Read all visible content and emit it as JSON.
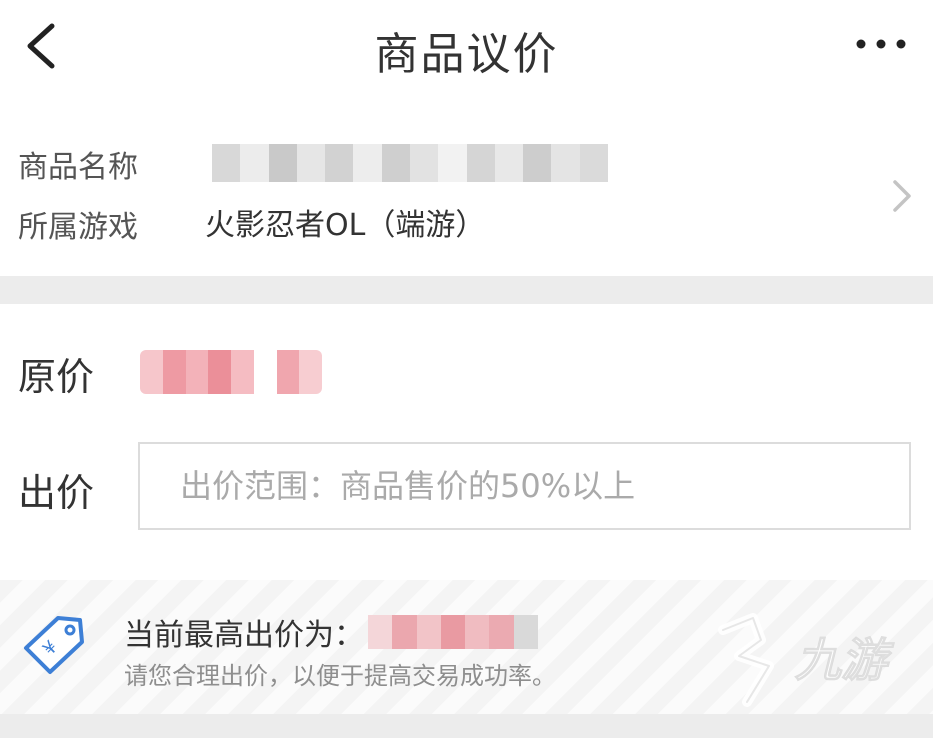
{
  "header": {
    "title": "商品议价",
    "back_icon": "chevron-left-icon",
    "more_icon": "more-horizontal-icon"
  },
  "product": {
    "name_label": "商品名称",
    "game_label": "所属游戏",
    "game_value": "火影忍者OL（端游）",
    "chevron_icon": "chevron-right-icon"
  },
  "pricing": {
    "original_label": "原价",
    "bid_label": "出价",
    "bid_placeholder": "出价范围：商品售价的50%以上",
    "bid_value": ""
  },
  "tip": {
    "icon": "price-tag-icon",
    "highest_prefix": "当前最高出价为：",
    "advice": "请您合理出价，以便于提高交易成功率。"
  },
  "watermark": {
    "text": "九游"
  },
  "colors": {
    "accent_blue": "#3d7fd6",
    "divider_gray": "#ececec",
    "placeholder_gray": "#aaaaaa",
    "price_blur_pink": "#f0aab0"
  }
}
